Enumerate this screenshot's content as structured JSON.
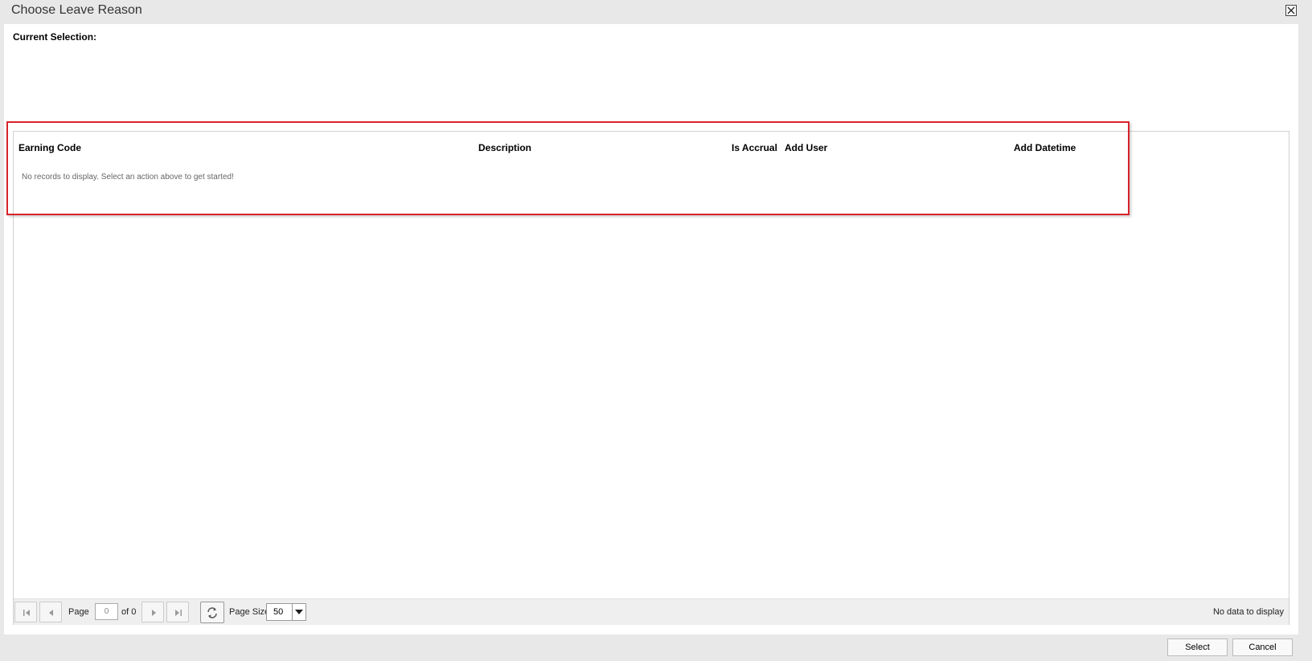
{
  "dialog": {
    "title": "Choose Leave Reason",
    "close_icon": "close-icon"
  },
  "current_selection": {
    "label": "Current Selection:"
  },
  "grid": {
    "columns": [
      "Earning Code",
      "Description",
      "Is Accrual",
      "Add User",
      "Add Datetime"
    ],
    "empty_message": "No records to display. Select an action above to get started!",
    "rows": []
  },
  "pager": {
    "page_label": "Page",
    "page_value": "0",
    "of_label": "of 0",
    "page_size_label": "Page Size",
    "page_size_value": "50",
    "status": "No data to display",
    "icons": [
      "first-page-icon",
      "prev-page-icon",
      "next-page-icon",
      "last-page-icon",
      "refresh-icon",
      "dropdown-arrow-icon"
    ]
  },
  "footer": {
    "select_label": "Select",
    "cancel_label": "Cancel"
  },
  "colors": {
    "highlight_border": "#d9232b",
    "dialog_bg": "#e8e8e8",
    "panel_bg": "#ffffff"
  }
}
